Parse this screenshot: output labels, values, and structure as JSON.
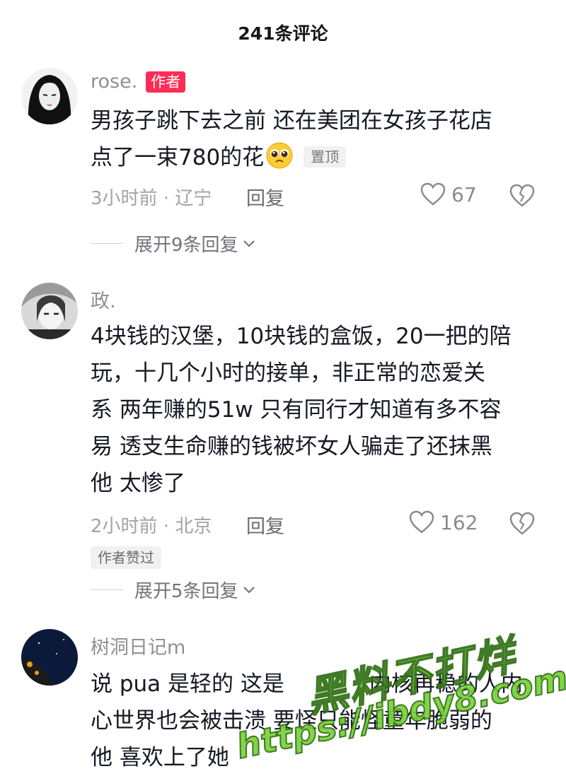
{
  "header": {
    "title": "241条评论"
  },
  "comments": [
    {
      "author": "rose.",
      "author_badge": "作者",
      "text_lines": [
        "男孩子跳下去之前 还在美团在女孩子花店",
        "点了一束780的花"
      ],
      "emoji_icon": "pleading-face-emoji",
      "pin_badge": "置顶",
      "meta": "3小时前 · 辽宁",
      "reply_label": "回复",
      "likes": "67",
      "expand_label": "展开9条回复"
    },
    {
      "author": "政.",
      "text_lines": [
        "4块钱的汉堡，10块钱的盒饭，20一把的陪",
        "玩，十几个小时的接单，非正常的恋爱关",
        "系 两年赚的51w 只有同行才知道有多不容",
        "易 透支生命赚的钱被坏女人骗走了还抹黑",
        "他 太惨了"
      ],
      "meta": "2小时前 · 北京",
      "reply_label": "回复",
      "likes": "162",
      "liked_by_author": "作者赞过",
      "expand_label": "展开5条回复"
    },
    {
      "author": "树洞日记m",
      "text_lines": [
        "说 pua 是轻的  这是",
        "心世界也会被击溃  要怪只能怪童年脆弱的",
        "他 喜欢上了她"
      ],
      "text_line1_tail": "内核再稳的人内"
    }
  ],
  "watermark": {
    "line1": "黑料不打烊",
    "line2": "https://ibdy8.com"
  },
  "colors": {
    "author_badge": "#fe2c55",
    "muted": "#8f8f96",
    "text": "#161823"
  }
}
